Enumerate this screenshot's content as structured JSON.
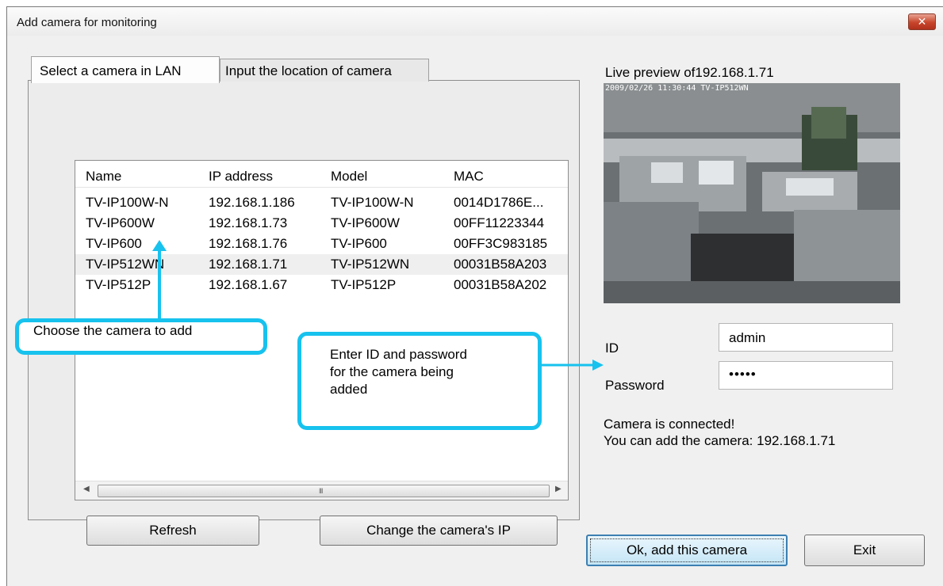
{
  "window": {
    "title": "Add camera for monitoring",
    "close_label": "✕"
  },
  "tabs": [
    {
      "label": "Select a camera in LAN",
      "active": true
    },
    {
      "label": "Input the location of camera",
      "active": false
    }
  ],
  "camera_list": {
    "columns": [
      "Name",
      "IP address",
      "Model",
      "MAC"
    ],
    "rows": [
      {
        "name": "TV-IP100W-N",
        "ip": "192.168.1.186",
        "model": "TV-IP100W-N",
        "mac": "0014D1786E..."
      },
      {
        "name": "TV-IP600W",
        "ip": "192.168.1.73",
        "model": "TV-IP600W",
        "mac": "00FF11223344"
      },
      {
        "name": "TV-IP600",
        "ip": "192.168.1.76",
        "model": "TV-IP600",
        "mac": "00FF3C983185"
      },
      {
        "name": "TV-IP512WN",
        "ip": "192.168.1.71",
        "model": "TV-IP512WN",
        "mac": "00031B58A203"
      },
      {
        "name": "TV-IP512P",
        "ip": "192.168.1.67",
        "model": "TV-IP512P",
        "mac": "00031B58A202"
      }
    ],
    "selected_row": 3,
    "scroll_grip": "III"
  },
  "buttons": {
    "refresh": "Refresh",
    "change_ip": "Change the camera's IP",
    "ok": "Ok, add this camera",
    "exit": "Exit"
  },
  "preview": {
    "label": "Live preview of192.168.1.71",
    "osd": "2009/02/26 11:30:44 TV-IP512WN"
  },
  "credentials": {
    "id_label": "ID",
    "id_value": "admin",
    "password_label": "Password",
    "password_value": "•••••"
  },
  "status": {
    "line1": "Camera is connected!",
    "line2": "You can add the camera: 192.168.1.71"
  },
  "callouts": {
    "choose": "Choose the camera to add",
    "enter_line1": "Enter ID and password",
    "enter_line2": "for the camera being",
    "enter_line3": "added"
  },
  "colors": {
    "callout_accent": "#17c2ee",
    "close_button": "#c8452b"
  }
}
